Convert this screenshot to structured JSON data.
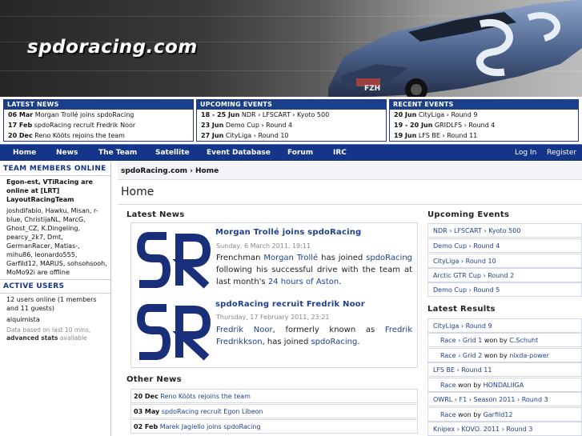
{
  "site": {
    "logo_text": "spdoracing.com"
  },
  "top_boxes": {
    "latest_news": {
      "title": "LATEST NEWS",
      "items": [
        {
          "date": "06 Mar",
          "text": "Morgan Trollé joins spdoRacing"
        },
        {
          "date": "17 Feb",
          "text": "spdoRacing recruit Fredrik Noor"
        },
        {
          "date": "20 Dec",
          "text": "Reno Kööts rejoins the team"
        }
      ]
    },
    "upcoming_events": {
      "title": "UPCOMING EVENTS",
      "items": [
        {
          "date": "18 - 25 Jun",
          "text": "NDR › LFSCART › Kyoto 500"
        },
        {
          "date": "23 Jun",
          "text": "Demo Cup › Round 4"
        },
        {
          "date": "27 Jun",
          "text": "CityLiga › Round 10"
        }
      ]
    },
    "recent_events": {
      "title": "RECENT EVENTS",
      "items": [
        {
          "date": "20 Jun",
          "text": "CityLiga › Round 9"
        },
        {
          "date": "19 - 20 Jun",
          "text": "GRIDLFS › Round 4"
        },
        {
          "date": "19 Jun",
          "text": "LFS BE › Round 11"
        }
      ]
    }
  },
  "nav": {
    "items": [
      "Home",
      "News",
      "The Team",
      "Satellite",
      "Event Database",
      "Forum",
      "IRC"
    ],
    "login": "Log In",
    "register": "Register"
  },
  "sidebar": {
    "team_title": "TEAM MEMBERS ONLINE",
    "team_online": "Egon-est, VTiRacing are online at [LRT] LayoutRacingTeam",
    "team_list": "joshdifabio, Hawku, Misan, r-blue, ChristijaNL, MarcG, Ghost_CZ, K.Dingeling, pearcy_2k7, Dmt, GermanRacer, Matias-, mihu86, leonardo555, Garfild12, MARUS, sohsohsooh, MoMo92i are offline",
    "active_title": "ACTIVE USERS",
    "active_count": "12 users online (1 members and 11 guests)",
    "active_member": "alquimista",
    "based_on": "Data based on last 10 mins,",
    "advanced_link": "advanced stats",
    "advanced_suffix": " available"
  },
  "breadcrumb": {
    "site": "spdoRacing.com",
    "sep": " › ",
    "page": "Home"
  },
  "page_title": "Home",
  "main": {
    "latest_news_heading": "Latest News",
    "articles": [
      {
        "title": "Morgan Trollé joins spdoRacing",
        "date": "Sunday, 6 March 2011, 19:11",
        "body_pre": "Frenchman ",
        "link1": "Morgan Trollé",
        "body_mid1": " has joined ",
        "link2": "spdoRacing",
        "body_mid2": " following his successful drive with the team at last month's ",
        "link3": "24 hours of Aston",
        "body_end": "."
      },
      {
        "title": "spdoRacing recruit Fredrik Noor",
        "date": "Thursday, 17 February 2011, 23:21",
        "link1": "Fredrik Noor",
        "body_mid1": ", formerly known as ",
        "link2": "Fredrik Fredrikkson",
        "body_mid2": ", has joined ",
        "link3": "spdoRacing",
        "body_end": "."
      }
    ],
    "other_news_heading": "Other News",
    "other_news": [
      {
        "date": "20 Dec",
        "text": "Reno Kööts rejoins the team"
      },
      {
        "date": "03 May",
        "text": "spdoRacing recruit Egon Libeon"
      },
      {
        "date": "02 Feb",
        "text": "Marek Jagiello joins spdoRacing"
      }
    ]
  },
  "right": {
    "upcoming_heading": "Upcoming Events",
    "upcoming": [
      "NDR › LFSCART › Kyoto 500",
      "Demo Cup › Round 4",
      "CityLiga › Round 10",
      "Arctic GTR Cup › Round 2",
      "Demo Cup › Round 5"
    ],
    "results_heading": "Latest Results",
    "results": [
      {
        "text": "CityLiga › Round 9",
        "sub": false
      },
      {
        "pre": "Race › Grid 1",
        "won": " won by ",
        "winner": "C.Schuht",
        "sub": true
      },
      {
        "pre": "Race › Grid 2",
        "won": " won by ",
        "winner": "nixda-power",
        "sub": true
      },
      {
        "text": "LFS BE › Round 11",
        "sub": false
      },
      {
        "pre": "Race",
        "won": " won by ",
        "winner": "HONDALIIGA",
        "sub": true
      },
      {
        "text": "OWRL › F1 › Season 2011 › Round 3",
        "sub": false
      },
      {
        "pre": "Race",
        "won": " won by ",
        "winner": "Garfild12",
        "sub": true
      },
      {
        "text": "Knipex › KOVO. 2011 › Round 3",
        "sub": false
      }
    ]
  },
  "colors": {
    "brand_blue": "#14358a",
    "link_blue": "#1f3f8f",
    "logo_blue": "#1a2f7a"
  }
}
